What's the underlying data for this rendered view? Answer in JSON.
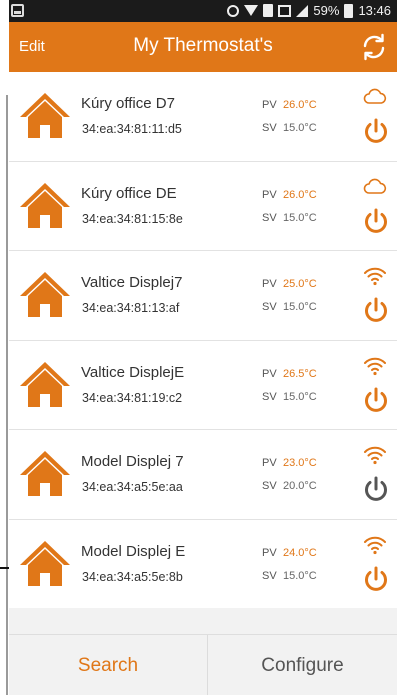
{
  "status_bar": {
    "battery_text": "59%",
    "time": "13:46",
    "icons": [
      "screen-icon",
      "alarm-icon",
      "wifi-icon",
      "sim-icon",
      "image-icon",
      "signal-icon",
      "battery-icon"
    ]
  },
  "header": {
    "edit_label": "Edit",
    "title": "My Thermostat's",
    "refresh_icon": "refresh-icon"
  },
  "labels": {
    "pv": "PV",
    "sv": "SV"
  },
  "colors": {
    "accent": "#e07718",
    "power_off": "#555555"
  },
  "devices": [
    {
      "name": "Kúry office D7",
      "mac": "34:ea:34:81:11:d5",
      "pv": "26.0°C",
      "sv": "15.0°C",
      "connection": "cloud",
      "power": "on"
    },
    {
      "name": "Kúry office DE",
      "mac": "34:ea:34:81:15:8e",
      "pv": "26.0°C",
      "sv": "15.0°C",
      "connection": "cloud",
      "power": "on"
    },
    {
      "name": "Valtice Displej7",
      "mac": "34:ea:34:81:13:af",
      "pv": "25.0°C",
      "sv": "15.0°C",
      "connection": "wifi",
      "power": "on"
    },
    {
      "name": "Valtice DisplejE",
      "mac": "34:ea:34:81:19:c2",
      "pv": "26.5°C",
      "sv": "15.0°C",
      "connection": "wifi",
      "power": "on"
    },
    {
      "name": "Model Displej 7",
      "mac": "34:ea:34:a5:5e:aa",
      "pv": "23.0°C",
      "sv": "20.0°C",
      "connection": "wifi",
      "power": "off"
    },
    {
      "name": "Model Displej E",
      "mac": "34:ea:34:a5:5e:8b",
      "pv": "24.0°C",
      "sv": "15.0°C",
      "connection": "wifi",
      "power": "on"
    }
  ],
  "bottom_bar": {
    "search_label": "Search",
    "configure_label": "Configure"
  }
}
